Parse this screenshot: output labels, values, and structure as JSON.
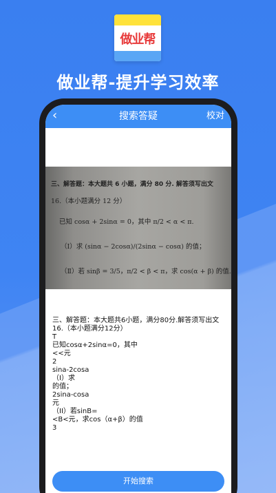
{
  "brand": {
    "logo_text": "做业帮",
    "tagline": "做业帮-提升学习效率"
  },
  "navbar": {
    "back_icon": "chevron-left-icon",
    "title": "搜索答疑",
    "action_label": "校对"
  },
  "photo_lines": [
    "三、解答题：本大题共 6 小题，满分 80 分. 解答须写出文",
    "16.（本小题满分 12 分）",
    "已知 cosα + 2sinα = 0，其中 π/2 < α < π.",
    "（Ⅰ）求 (sinα − 2cosα)/(2sinα − cosα) 的值；",
    "（Ⅱ）若 sinβ = 3/5，π/2 < β < π，求 cos(α + β) 的值."
  ],
  "ocr_lines": [
    "三、解答题：本大题共6小题，满分80分.解答须写出文",
    "16.（本小题满分12分）",
    "T",
    "已知cosα+2sinα=0，其中",
    "<<元",
    "2",
    "sina-2cosa",
    "（I）求",
    "的值；",
    "2sina-cosa",
    "元",
    "（II）若sinB=",
    "<B<元，求cos（α+β）的值",
    "3"
  ],
  "start_button_label": "开始搜索",
  "colors": {
    "background": "#3f84f3",
    "navbar": "#3d8ef5",
    "button": "#3d8ef5",
    "logo_yellow": "#ffe23a",
    "logo_blue": "#5aa6f5",
    "logo_red": "#e83b3b"
  }
}
